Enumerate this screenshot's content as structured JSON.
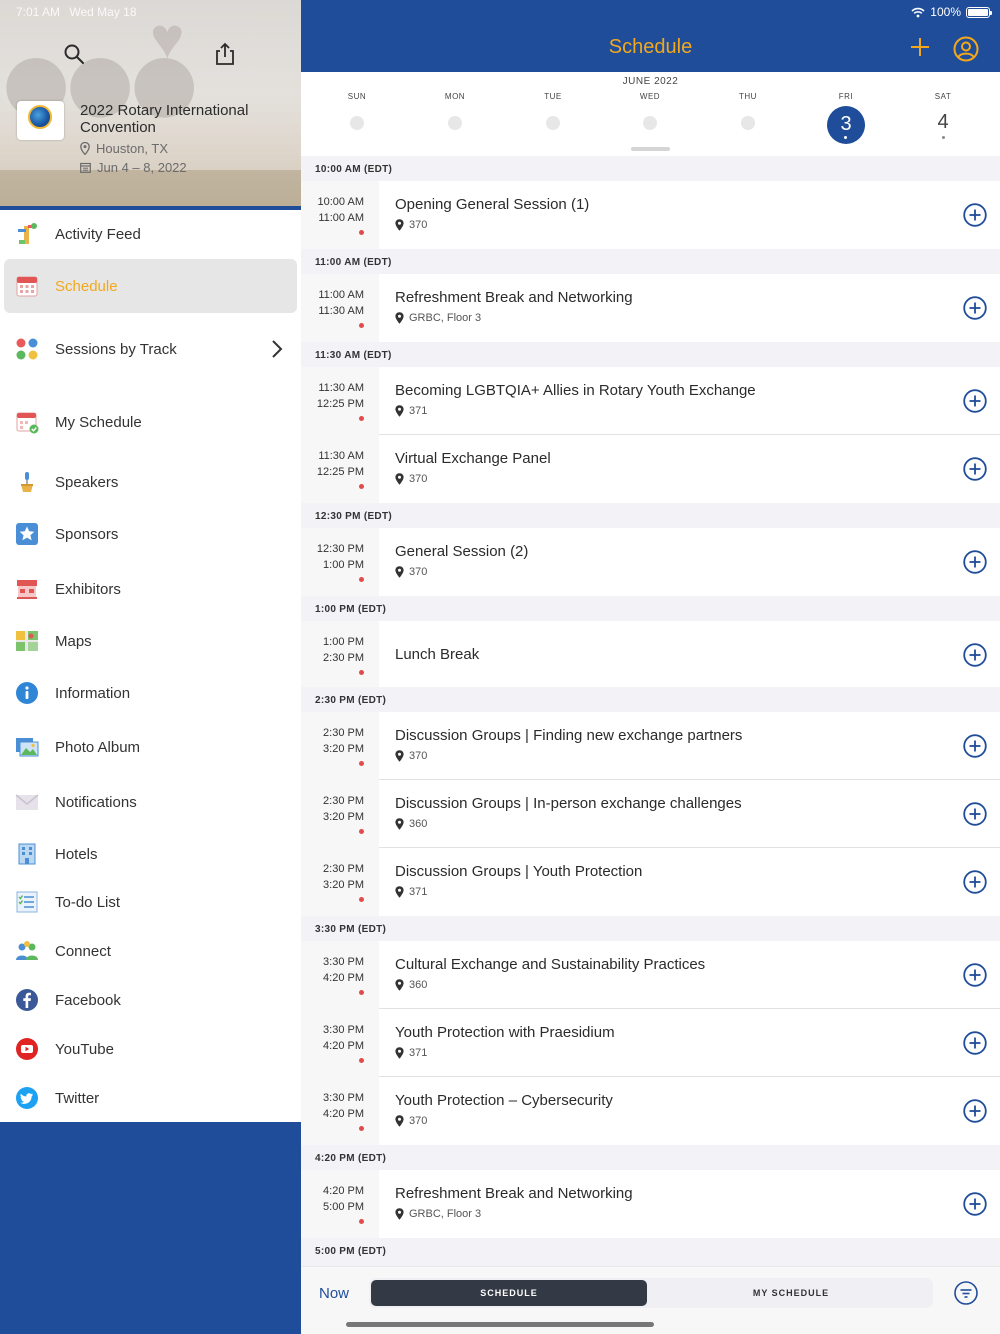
{
  "status": {
    "time": "7:01 AM",
    "day": "Wed May 18",
    "battery": "100%"
  },
  "conference": {
    "title": "2022 Rotary International Convention",
    "location": "Houston, TX",
    "dates": "Jun 4 – 8, 2022"
  },
  "sidebar": {
    "items": [
      {
        "label": "Activity Feed",
        "icon": "activity-feed-icon"
      },
      {
        "label": "Schedule",
        "icon": "calendar-icon"
      },
      {
        "label": "Sessions by Track",
        "icon": "tracks-icon"
      },
      {
        "label": "My Schedule",
        "icon": "my-schedule-icon"
      },
      {
        "label": "Speakers",
        "icon": "speaker-icon"
      },
      {
        "label": "Sponsors",
        "icon": "star-icon"
      },
      {
        "label": "Exhibitors",
        "icon": "exhibitor-icon"
      },
      {
        "label": "Maps",
        "icon": "map-icon"
      },
      {
        "label": "Information",
        "icon": "info-icon"
      },
      {
        "label": "Photo Album",
        "icon": "photo-icon"
      },
      {
        "label": "Notifications",
        "icon": "envelope-icon"
      },
      {
        "label": "Hotels",
        "icon": "hotel-icon"
      },
      {
        "label": "To-do List",
        "icon": "checklist-icon"
      },
      {
        "label": "Connect",
        "icon": "people-icon"
      },
      {
        "label": "Facebook",
        "icon": "facebook-icon"
      },
      {
        "label": "YouTube",
        "icon": "youtube-icon"
      },
      {
        "label": "Twitter",
        "icon": "twitter-icon"
      }
    ]
  },
  "header": {
    "title": "Schedule"
  },
  "calendar": {
    "month": "JUNE 2022",
    "days": [
      {
        "name": "SUN",
        "num": ""
      },
      {
        "name": "MON",
        "num": ""
      },
      {
        "name": "TUE",
        "num": ""
      },
      {
        "name": "WED",
        "num": ""
      },
      {
        "name": "THU",
        "num": ""
      },
      {
        "name": "FRI",
        "num": "3"
      },
      {
        "name": "SAT",
        "num": "4"
      }
    ]
  },
  "schedule": {
    "sections": [
      {
        "header": "10:00 AM (EDT)",
        "sessions": [
          {
            "start": "10:00 AM",
            "end": "11:00 AM",
            "title": "Opening General Session (1)",
            "location": "370"
          }
        ]
      },
      {
        "header": "11:00 AM (EDT)",
        "sessions": [
          {
            "start": "11:00 AM",
            "end": "11:30 AM",
            "title": "Refreshment Break and Networking",
            "location": "GRBC, Floor 3"
          }
        ]
      },
      {
        "header": "11:30 AM (EDT)",
        "sessions": [
          {
            "start": "11:30 AM",
            "end": "12:25 PM",
            "title": "Becoming LGBTQIA+ Allies in Rotary Youth Exchange",
            "location": "371"
          },
          {
            "start": "11:30 AM",
            "end": "12:25 PM",
            "title": "Virtual Exchange Panel",
            "location": "370"
          }
        ]
      },
      {
        "header": "12:30 PM (EDT)",
        "sessions": [
          {
            "start": "12:30 PM",
            "end": "1:00 PM",
            "title": "General Session (2)",
            "location": "370"
          }
        ]
      },
      {
        "header": "1:00 PM (EDT)",
        "sessions": [
          {
            "start": "1:00 PM",
            "end": "2:30 PM",
            "title": "Lunch Break",
            "location": ""
          }
        ]
      },
      {
        "header": "2:30 PM (EDT)",
        "sessions": [
          {
            "start": "2:30 PM",
            "end": "3:20 PM",
            "title": "Discussion Groups | Finding new exchange partners",
            "location": "370"
          },
          {
            "start": "2:30 PM",
            "end": "3:20 PM",
            "title": "Discussion Groups | In-person exchange challenges",
            "location": "360"
          },
          {
            "start": "2:30 PM",
            "end": "3:20 PM",
            "title": "Discussion Groups | Youth Protection",
            "location": "371"
          }
        ]
      },
      {
        "header": "3:30 PM (EDT)",
        "sessions": [
          {
            "start": "3:30 PM",
            "end": "4:20 PM",
            "title": "Cultural Exchange and Sustainability Practices",
            "location": "360"
          },
          {
            "start": "3:30 PM",
            "end": "4:20 PM",
            "title": "Youth Protection with Praesidium",
            "location": "371"
          },
          {
            "start": "3:30 PM",
            "end": "4:20 PM",
            "title": "Youth Protection – Cybersecurity",
            "location": "370"
          }
        ]
      },
      {
        "header": "4:20 PM (EDT)",
        "sessions": [
          {
            "start": "4:20 PM",
            "end": "5:00 PM",
            "title": "Refreshment Break and Networking",
            "location": "GRBC, Floor 3"
          }
        ]
      },
      {
        "header": "5:00 PM (EDT)",
        "sessions": []
      }
    ]
  },
  "bottom": {
    "now": "Now",
    "schedule_tab": "SCHEDULE",
    "my_schedule_tab": "MY SCHEDULE"
  },
  "colors": {
    "brand_blue": "#1f4d99",
    "accent_orange": "#f3a81c",
    "alert_red": "#e24b4b"
  }
}
